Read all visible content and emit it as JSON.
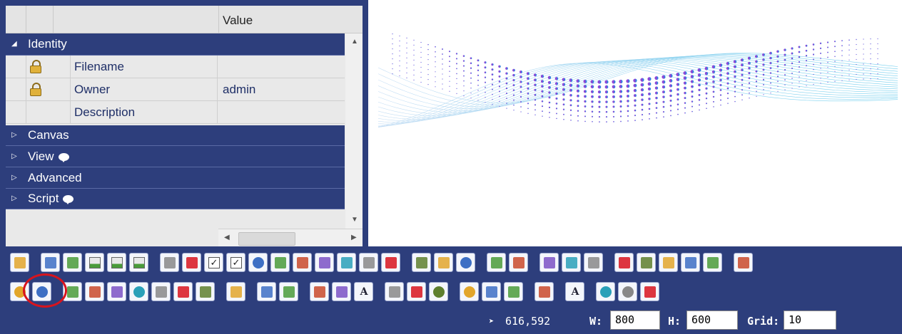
{
  "property_grid": {
    "header_value": "Value",
    "categories": [
      {
        "label": "Identity",
        "expanded": true
      },
      {
        "label": "Canvas",
        "expanded": false
      },
      {
        "label": "View",
        "expanded": false,
        "info_icon": true
      },
      {
        "label": "Advanced",
        "expanded": false
      },
      {
        "label": "Script",
        "expanded": false,
        "info_icon": true
      }
    ],
    "rows": [
      {
        "name": "Filename",
        "value": "",
        "locked": true
      },
      {
        "name": "Owner",
        "value": "admin",
        "locked": true
      },
      {
        "name": "Description",
        "value": "",
        "locked": false
      }
    ]
  },
  "toolbar": {
    "row1_icons": [
      "bell-icon",
      "panel-icon",
      "panel-dark-icon",
      "bar-chart-icon",
      "area-chart-icon",
      "area-chart-2-icon",
      "button-icon",
      "button-2-icon",
      "checkbox-icon",
      "checkbox-2-icon",
      "radio-icon",
      "textbox-icon",
      "resize-icon",
      "text-add-icon",
      "text-add-2-icon",
      "download-icon",
      "device-icon",
      "calendar-icon",
      "date-15-icon",
      "clock-icon",
      "color-picker-icon",
      "machine-1-icon",
      "machine-2-icon",
      "machine-3-icon",
      "machine-4-icon",
      "machine-5-icon",
      "machine-6-icon",
      "machine-7-icon",
      "machine-8-icon",
      "machine-9-icon",
      "machine-10-icon"
    ],
    "row2_icons": [
      "globe-icon",
      "gauge-icon",
      "scatter-icon",
      "ruler-icon",
      "curve-icon",
      "dial-icon",
      "sparkline-icon",
      "tank-icon",
      "slider-icon",
      "book-icon",
      "image-icon",
      "image-grid-icon",
      "text-frame-icon",
      "picture-icon",
      "font-a-icon",
      "mountain-text-icon",
      "flag-text-icon",
      "record-icon",
      "ellipse-icon",
      "rectangle-icon",
      "octagon-icon",
      "gear-icon",
      "font-a-small-icon",
      "knob-icon",
      "knob-2-icon",
      "level-icon"
    ]
  },
  "status": {
    "coords": "616,592",
    "width_label": "W:",
    "width_value": "800",
    "height_label": "H:",
    "height_value": "600",
    "grid_label": "Grid:",
    "grid_value": "10"
  },
  "colors": {
    "accent": "#2d3e7c",
    "highlight": "#d8141d"
  }
}
